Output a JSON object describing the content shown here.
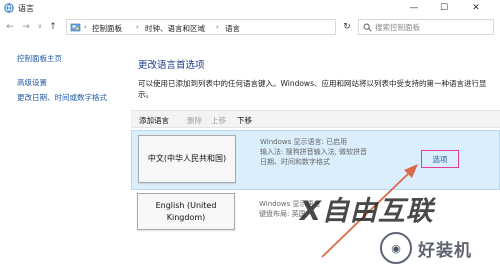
{
  "window": {
    "title": "语言",
    "controls": {
      "minimize": "—",
      "maximize": "☐",
      "close": "✕"
    }
  },
  "nav": {
    "back": "←",
    "forward": "→",
    "recent": "∨",
    "up": "↑",
    "breadcrumbs": [
      "控制面板",
      "时钟、语言和区域",
      "语言"
    ],
    "separator": "›",
    "dropdown": "∨",
    "refresh": "↻",
    "search_placeholder": "搜索控制面板"
  },
  "sidebar": {
    "items": [
      "控制面板主页",
      "高级设置",
      "更改日期、时间或数字格式"
    ]
  },
  "main": {
    "heading": "更改语言首选项",
    "description": "可以使用已添加到列表中的任何语言键入。Windows、应用和网站将以列表中受支持的第一种语言进行显示。",
    "toolbar": {
      "add": "添加语言",
      "delete": "删除",
      "up": "上移",
      "down": "下移"
    },
    "languages": [
      {
        "name": "中文(中华人民共和国)",
        "info": [
          "Windows 显示语言: 已启用",
          "输入法: 搜狗拼音输入法, 微软拼音",
          "日期、时间和数字格式"
        ],
        "options_label": "选项"
      },
      {
        "name": "English (United Kingdom)",
        "info": [
          "Windows 显示语言",
          "键盘布局: 英国"
        ]
      }
    ]
  },
  "watermark": {
    "main": "X自由互联",
    "badge": "◉",
    "sub": "好装机"
  },
  "colors": {
    "link": "#1f5aa6",
    "heading": "#1e3a8a",
    "selected_row": "#dbeefc",
    "highlight_box": "#e93b9b",
    "arrow": "#d96a4a"
  }
}
